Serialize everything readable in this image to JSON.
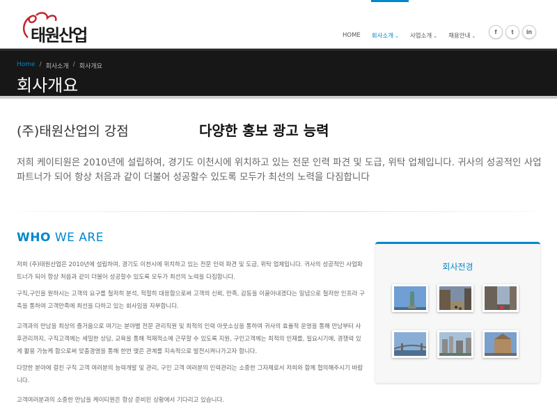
{
  "brand": {
    "logo_text": "태원산업"
  },
  "nav": {
    "items": [
      {
        "label": "HOME",
        "active": false,
        "caret": ""
      },
      {
        "label": "회사소개",
        "active": true,
        "caret": "⌄"
      },
      {
        "label": "사업소개",
        "active": false,
        "caret": "⌄"
      },
      {
        "label": "채용안내",
        "active": false,
        "caret": "⌄"
      }
    ],
    "social": [
      "f",
      "t",
      "in"
    ]
  },
  "breadcrumb": {
    "home": "Home",
    "parent": "회사소개",
    "current": "회사개요"
  },
  "page_title": "회사개요",
  "intro": {
    "left": "(주)태원산업의 강점",
    "right": "다양한 홍보 광고 능력",
    "lead": "저희 케이티원은 2010년에 설립하여, 경기도 이천시에 위치하고 있는 전문 인력 파견 및 도급, 위탁 업체입니다. 귀사의 성공적인 사업파트너가 되어 항상 처음과 같이 더불어 성공할수 있도록 모두가 최선의 노력을 다짐합니다"
  },
  "who": {
    "heading_bold": "WHO",
    "heading_rest": "WE ARE",
    "paragraphs": [
      "저희 (주)태원산업은 2010년에 설립하여, 경기도 이천시에 위치하고 있는 전문 인력 파견 및 도급, 위탁 업체입니다. 귀사의 성공적인 사업파트너가 되어 항상 처음과 같이 더불어 성공할수 있도록 모두가 최선의 노력을 다짐합니다.",
      "구직,구인을 원하시는 고객의 요구를 철저히 분석, 적절히 대응함으로써 고객의 신뢰, 만족, 감동을 이끌어내겠다는 일념으로 철저한 인프라 구축을 통하여 고객만족에 최선을 다하고 있는 회사임을 자부합니다.",
      "고객과의 만남을 최상의 즐거움으로 여기는 분야별 전문 관리직원 및 최적의 인력 아웃소싱을 통하여 귀사의 효율적 운영을 통해 만남부터 사후관리까지, 구직고객께는 세밀한 상담, 교육을 통해 적재적소에 근무할 수 있도록 지원, 구인고객께는 최적의 인재를, 필요시기에, 경쟁력 있게 활용 가능케 함으로써 맞춤경영을 통해 한번 맺은 관계를 지속적으로 발전시켜나가고자 합니다.",
      "다양한 분야에 걸친 구직 고객 여러분의 능력개발 및 관리, 구인 고객 여러분의 인력관리는 소중한 그자체로서 저희와 함께 협의해주시기 바랍니다.",
      "고객여러분과의 소중한 만남을 케이티원은 항상 준비된 상황에서 기다리고 있습니다."
    ]
  },
  "sidebar": {
    "title": "회사전경",
    "thumbnails": [
      "statue-of-liberty",
      "city-square",
      "city-street",
      "river-bridge",
      "riverside-city",
      "old-building"
    ]
  },
  "colors": {
    "accent": "#0088cc",
    "titlebar": "#171717"
  }
}
